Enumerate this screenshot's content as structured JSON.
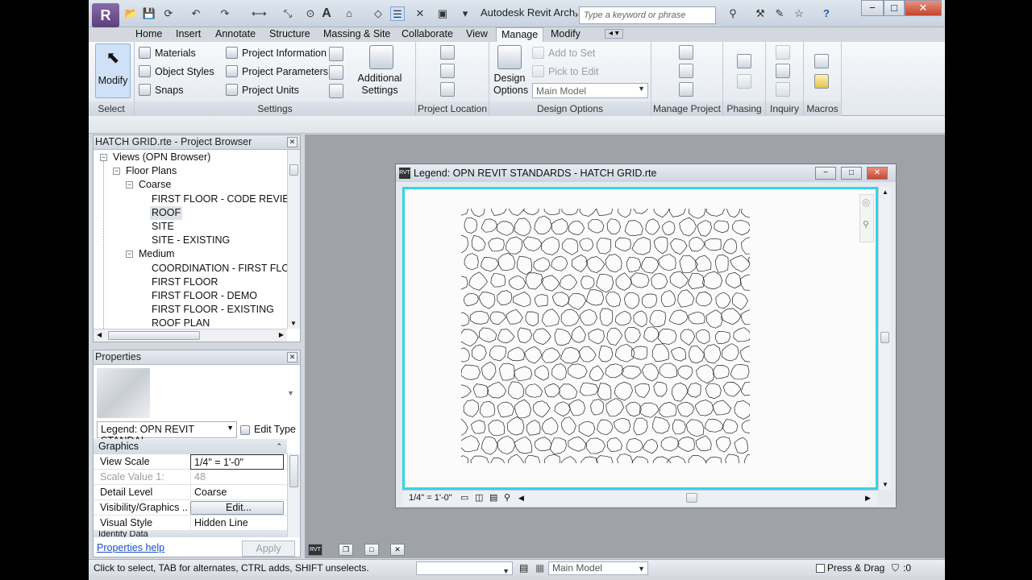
{
  "app": {
    "title": "Autodesk Revit Arch...",
    "search_placeholder": "Type a keyword or phrase",
    "window_controls": [
      "−",
      "□",
      "✕"
    ]
  },
  "ribbon_tabs": [
    "Home",
    "Insert",
    "Annotate",
    "Structure",
    "Massing & Site",
    "Collaborate",
    "View",
    "Manage",
    "Modify"
  ],
  "active_tab": "Manage",
  "ribbon": {
    "select": {
      "button": "Modify",
      "label": "Select"
    },
    "settings": {
      "label": "Settings",
      "items": [
        "Materials",
        "Object Styles",
        "Snaps",
        "Project Information",
        "Project Parameters",
        "Project Units"
      ],
      "additional": "Additional Settings"
    },
    "project_location": {
      "label": "Project Location"
    },
    "design_options": {
      "label": "Design Options",
      "button": "Design Options",
      "add_to_set": "Add to Set",
      "pick_to_edit": "Pick to Edit",
      "dropdown": "Main Model"
    },
    "manage_project": {
      "label": "Manage Project"
    },
    "phasing": {
      "label": "Phasing"
    },
    "inquiry": {
      "label": "Inquiry"
    },
    "macros": {
      "label": "Macros"
    }
  },
  "project_browser": {
    "title": "HATCH GRID.rte - Project Browser",
    "rows": [
      {
        "text": "Views (OPN Browser)",
        "level": 0,
        "expander": "−"
      },
      {
        "text": "Floor Plans",
        "level": 1,
        "expander": "−"
      },
      {
        "text": "Coarse",
        "level": 2,
        "expander": "−"
      },
      {
        "text": "FIRST FLOOR - CODE REVIEW",
        "level": 3
      },
      {
        "text": "ROOF",
        "level": 3,
        "selected": true
      },
      {
        "text": "SITE",
        "level": 3
      },
      {
        "text": "SITE - EXISTING",
        "level": 3
      },
      {
        "text": "Medium",
        "level": 2,
        "expander": "−"
      },
      {
        "text": "COORDINATION - FIRST FLOOR",
        "level": 3
      },
      {
        "text": "FIRST FLOOR",
        "level": 3
      },
      {
        "text": "FIRST FLOOR - DEMO",
        "level": 3
      },
      {
        "text": "FIRST FLOOR - EXISTING",
        "level": 3
      },
      {
        "text": "ROOF PLAN",
        "level": 3
      }
    ]
  },
  "properties": {
    "title": "Properties",
    "type_selector": "Legend: OPN REVIT STANDAI",
    "edit_type": "Edit Type",
    "group_graphics": "Graphics",
    "rows": [
      {
        "k": "View Scale",
        "v": "1/4\" = 1'-0\""
      },
      {
        "k": "Scale Value    1:",
        "v": "48",
        "disabled": true
      },
      {
        "k": "Detail Level",
        "v": "Coarse"
      },
      {
        "k": "Visibility/Graphics ...",
        "v": "Edit..."
      },
      {
        "k": "Visual Style",
        "v": "Hidden Line"
      }
    ],
    "group_identity": "Identity Data",
    "help": "Properties help",
    "apply": "Apply"
  },
  "view_window": {
    "title": "Legend: OPN REVIT STANDARDS - HATCH GRID.rte",
    "scale": "1/4\" = 1'-0\""
  },
  "status": {
    "text": "Click to select, TAB for alternates, CTRL adds, SHIFT unselects.",
    "model": "Main Model",
    "press_drag": "Press & Drag",
    "filter_count": ":0"
  }
}
